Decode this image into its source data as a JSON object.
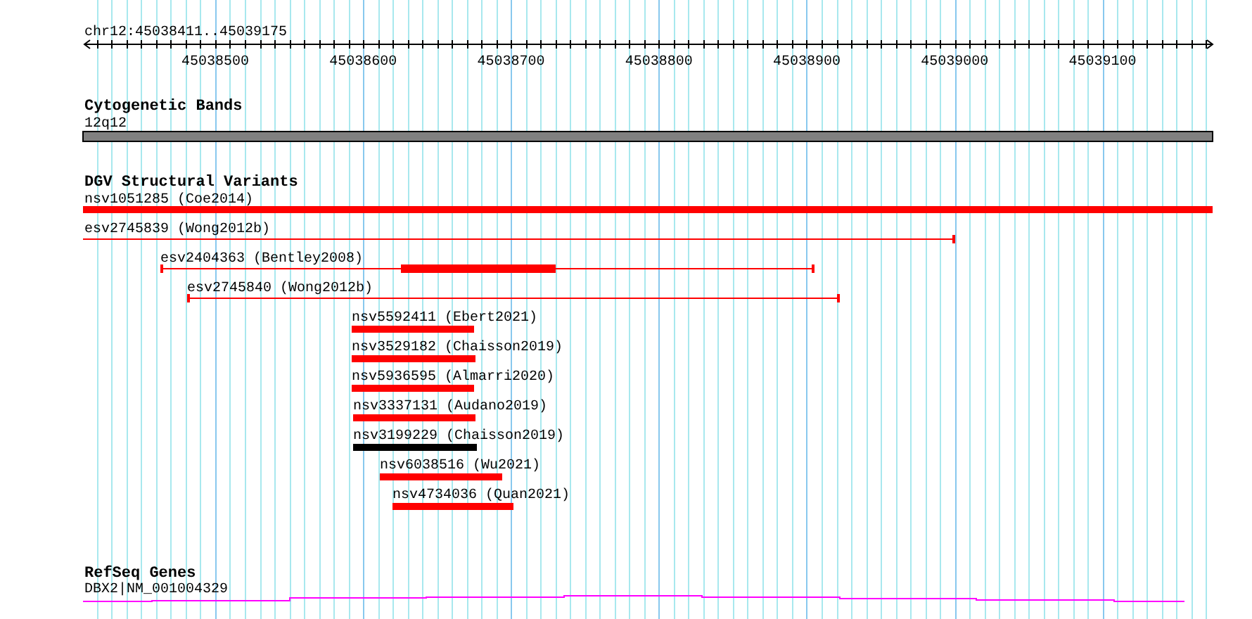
{
  "ruler": {
    "range_label": "chr12:45038411..45039175",
    "ticks": [
      "45038500",
      "45038600",
      "45038700",
      "45038800",
      "45038900",
      "45039000",
      "45039100"
    ]
  },
  "tracks": [
    {
      "title": "Cytogenetic Bands",
      "features": [
        {
          "label": "12q12",
          "kind": "band"
        }
      ]
    },
    {
      "title": "DGV Structural Variants",
      "features": [
        {
          "label": "nsv1051285 (Coe2014)",
          "kind": "bar",
          "color": "#ff0000"
        },
        {
          "label": "esv2745839 (Wong2012b)",
          "kind": "line",
          "color": "#ff0000"
        },
        {
          "label": "esv2404363 (Bentley2008)",
          "kind": "gapped",
          "color": "#ff0000"
        },
        {
          "label": "esv2745840 (Wong2012b)",
          "kind": "line",
          "color": "#ff0000"
        },
        {
          "label": "nsv5592411 (Ebert2021)",
          "kind": "bar",
          "color": "#ff0000"
        },
        {
          "label": "nsv3529182 (Chaisson2019)",
          "kind": "bar",
          "color": "#ff0000"
        },
        {
          "label": "nsv5936595 (Almarri2020)",
          "kind": "bar",
          "color": "#ff0000"
        },
        {
          "label": "nsv3337131 (Audano2019)",
          "kind": "bar",
          "color": "#ff0000"
        },
        {
          "label": "nsv3199229 (Chaisson2019)",
          "kind": "bar",
          "color": "#000000"
        },
        {
          "label": "nsv6038516 (Wu2021)",
          "kind": "bar",
          "color": "#ff0000"
        },
        {
          "label": "nsv4734036 (Quan2021)",
          "kind": "bar",
          "color": "#ff0000"
        }
      ]
    },
    {
      "title": "RefSeq Genes",
      "features": [
        {
          "label": "DBX2|NM_001004329",
          "kind": "gene"
        }
      ]
    }
  ]
}
